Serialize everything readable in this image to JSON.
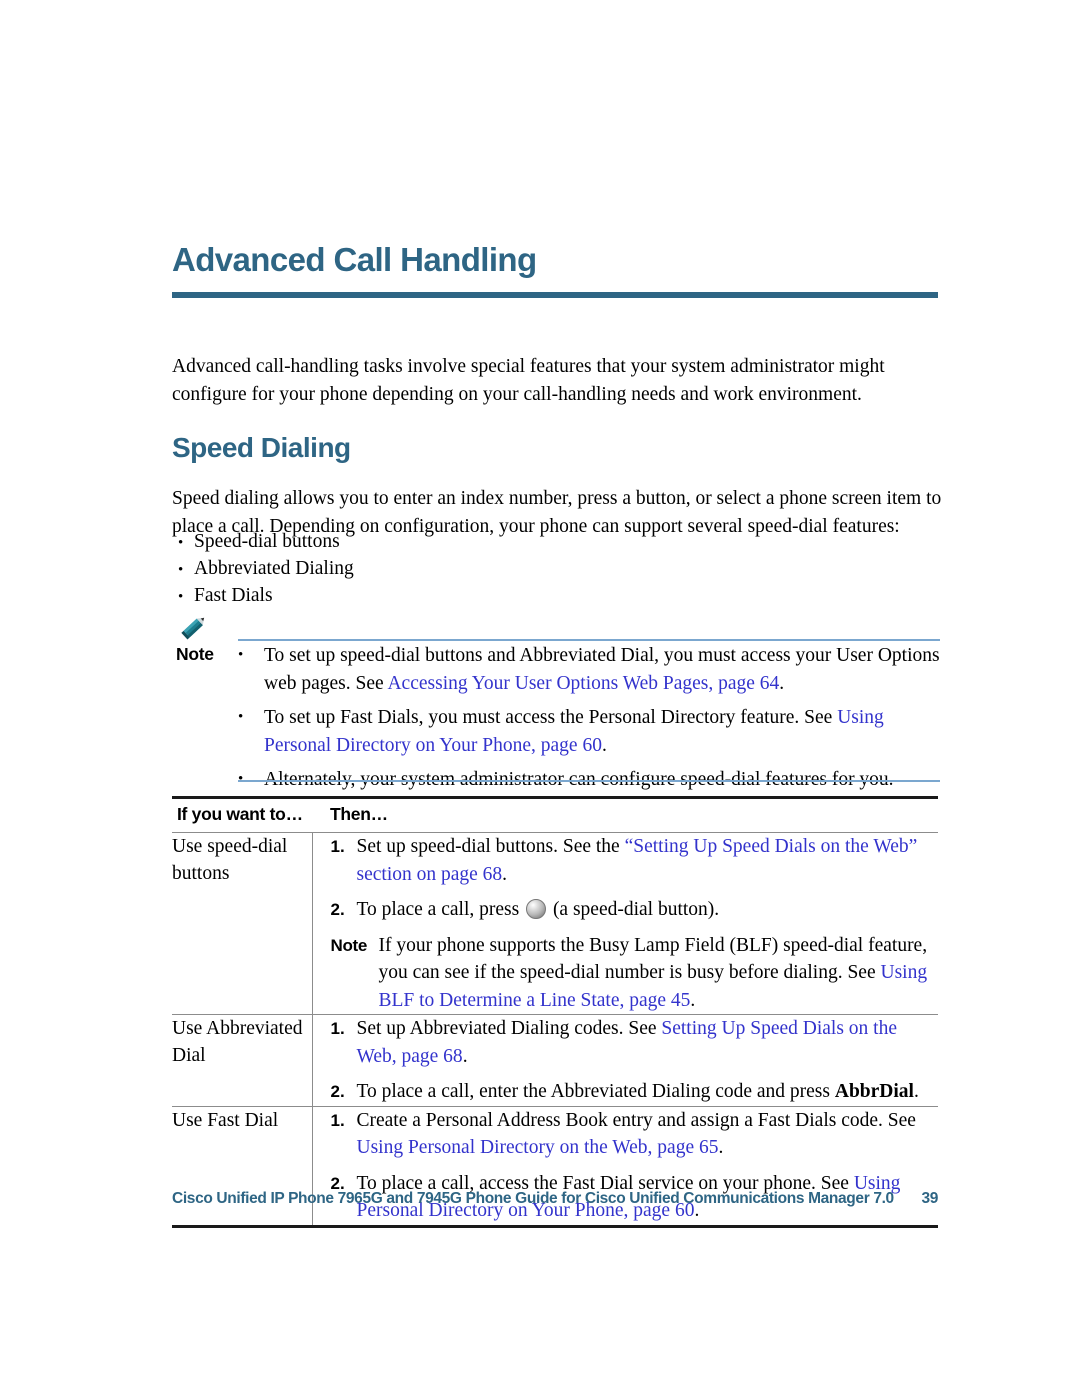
{
  "document": {
    "chapter_title": "Advanced Call Handling",
    "intro_paragraph": "Advanced call-handling tasks involve special features that your system administrator might configure for your phone depending on your call-handling needs and work environment."
  },
  "section": {
    "heading": "Speed Dialing",
    "paragraph": "Speed dialing allows you to enter an index number, press a button, or select a phone screen item to place a call. Depending on configuration, your phone can support several speed-dial features:",
    "bullets": [
      "Speed-dial buttons",
      "Abbreviated Dialing",
      "Fast Dials"
    ]
  },
  "note": {
    "icon": "pencil-icon",
    "label": "Note",
    "bullet_glyph": "•",
    "items": [
      {
        "pre": "To set up speed-dial buttons and Abbreviated Dial, you must access your User Options web pages. See ",
        "link": "Accessing Your User Options Web Pages, page 64",
        "post": "."
      },
      {
        "pre": "To set up Fast Dials, you must access the Personal Directory feature. See ",
        "link": "Using Personal Directory on Your Phone, page 60",
        "post": "."
      },
      {
        "pre": "Alternately, your system administrator can configure speed-dial features for you.",
        "link": "",
        "post": ""
      }
    ]
  },
  "table": {
    "headers": [
      "If you want to…",
      "Then…"
    ],
    "rows": [
      {
        "task": "Use speed-dial buttons",
        "steps": [
          {
            "num": "1.",
            "kind": "step",
            "pre": "Set up speed-dial buttons. See the ",
            "link": "“Setting Up Speed Dials on the Web” section on page 68",
            "post": "."
          },
          {
            "num": "2.",
            "kind": "step-with-icon",
            "pre": "To place a call, press ",
            "icon": "speed-dial-button-icon",
            "post": " (a speed-dial button)."
          },
          {
            "num": "Note",
            "kind": "note",
            "pre": "If your phone supports the Busy Lamp Field (BLF) speed-dial feature, you can see if the speed-dial number is busy before dialing. See ",
            "link": "Using BLF to Determine a Line State, page 45",
            "post": "."
          }
        ]
      },
      {
        "task": "Use Abbreviated Dial",
        "steps": [
          {
            "num": "1.",
            "kind": "step",
            "pre": "Set up Abbreviated Dialing codes. See ",
            "link": "Setting Up Speed Dials on the Web, page 68",
            "post": "."
          },
          {
            "num": "2.",
            "kind": "step-with-bold",
            "pre": "To place a call, enter the Abbreviated Dialing code and press ",
            "bold": "AbbrDial",
            "post": "."
          }
        ]
      },
      {
        "task": "Use Fast Dial",
        "steps": [
          {
            "num": "1.",
            "kind": "step",
            "pre": "Create a Personal Address Book entry and assign a Fast Dials code. See ",
            "link": "Using Personal Directory on the Web, page 65",
            "post": "."
          },
          {
            "num": "2.",
            "kind": "step",
            "pre": "To place a call, access the Fast Dial service on your phone. See ",
            "link": "Using Personal Directory on Your Phone, page 60",
            "post": "."
          }
        ]
      }
    ]
  },
  "footer": {
    "text": "Cisco Unified IP Phone 7965G and 7945G Phone Guide for Cisco Unified Communications Manager 7.0",
    "page_number": "39"
  },
  "colors": {
    "heading": "#2e6584",
    "link": "#3333cc",
    "note_rule": "#7ba7cf",
    "table_border": "#1a1a1a",
    "pencil": "#17707f"
  }
}
